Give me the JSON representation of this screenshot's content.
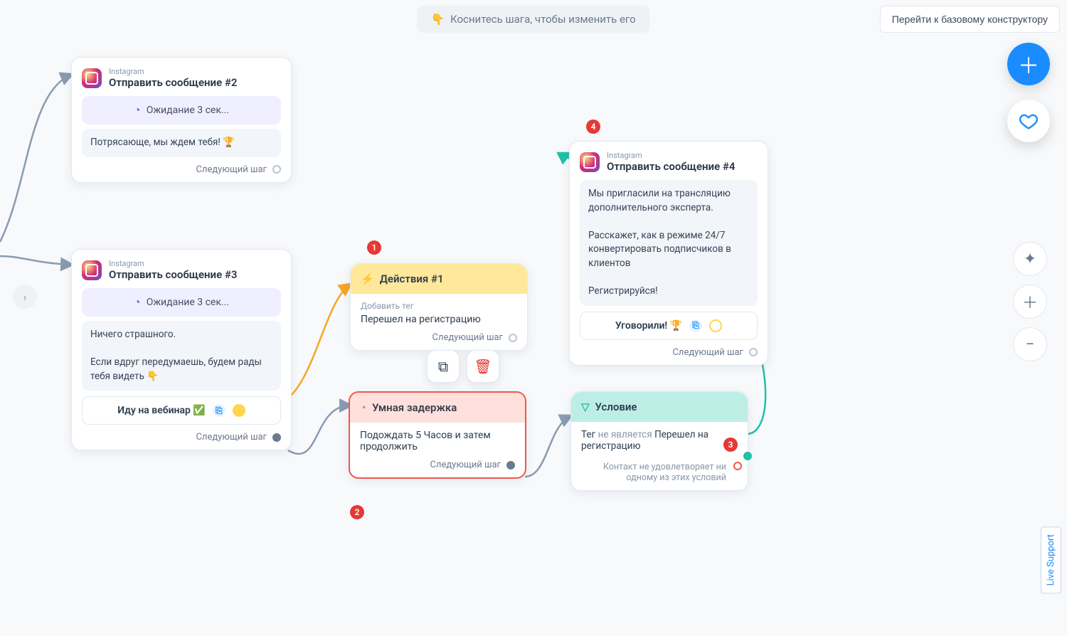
{
  "hint": {
    "emoji": "👇",
    "text": "Коснитесь шага, чтобы изменить его"
  },
  "topRightBtn": "Перейти к базовому конструктору",
  "liveSupport": "Live Support",
  "nextStepLabel": "Следующий шаг",
  "nodes": {
    "msg2": {
      "kicker": "Instagram",
      "title": "Отправить сообщение #2",
      "wait": "Ожидание 3 сек...",
      "body": "Потрясающе, мы ждем тебя! 🏆"
    },
    "msg3": {
      "kicker": "Instagram",
      "title": "Отправить сообщение #3",
      "wait": "Ожидание 3 сек...",
      "body1": "Ничего страшного.",
      "body2": "Если вдруг передумаешь, будем рады тебя видеть 👇",
      "button": "Иду на вебинар ✅"
    },
    "action1": {
      "title": "Действия #1",
      "sub": "Добавить тег",
      "text": "Перешел на регистрацию"
    },
    "delay": {
      "title": "Умная задержка",
      "text": "Подождать 5 Часов и затем продолжить"
    },
    "cond": {
      "title": "Условие",
      "line_prefix": "Тег",
      "line_negation": "не является",
      "line_value": "Перешел на регистрацию",
      "fallback": "Контакт не удовлетворяет ни одному из этих условий"
    },
    "msg4": {
      "kicker": "Instagram",
      "title": "Отправить сообщение #4",
      "body1": "Мы пригласили на трансляцию дополнительного эксперта.",
      "body2": "Расскажет, как в режиме 24/7 конвертировать подписчиков в клиентов",
      "body3": "Регистрируйся!",
      "button": "Уговорили! 🏆"
    }
  },
  "badges": {
    "b1": "1",
    "b2": "2",
    "b3": "3",
    "b4": "4"
  }
}
